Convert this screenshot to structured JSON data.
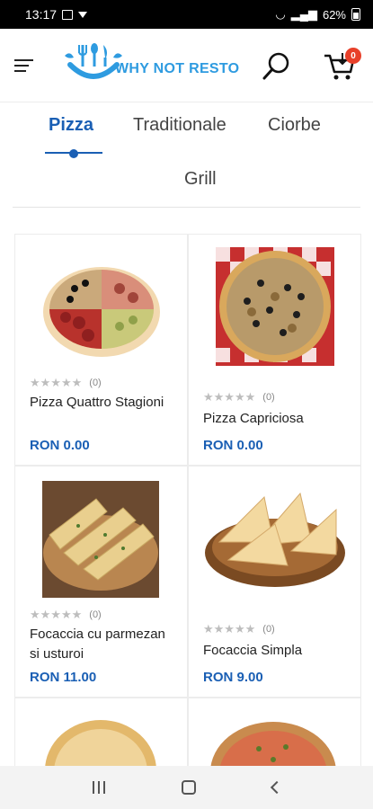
{
  "status": {
    "time": "13:17",
    "battery": "62%"
  },
  "header": {
    "logo_text": "WHY NOT RESTO",
    "cart_count": "0"
  },
  "tabs": [
    "Pizza",
    "Traditionale",
    "Ciorbe",
    "Grill"
  ],
  "products": [
    {
      "name": "Pizza Quattro Stagioni",
      "rating_count": "(0)",
      "price": "RON 0.00"
    },
    {
      "name": "Pizza Capriciosa",
      "rating_count": "(0)",
      "price": "RON 0.00"
    },
    {
      "name": "Focaccia cu parmezan si usturoi",
      "rating_count": "(0)",
      "price": "RON 11.00"
    },
    {
      "name": "Focaccia Simpla",
      "rating_count": "(0)",
      "price": "RON 9.00"
    }
  ],
  "colors": {
    "accent": "#1a5fb4",
    "logo": "#2e9be0",
    "badge": "#e8402a"
  }
}
